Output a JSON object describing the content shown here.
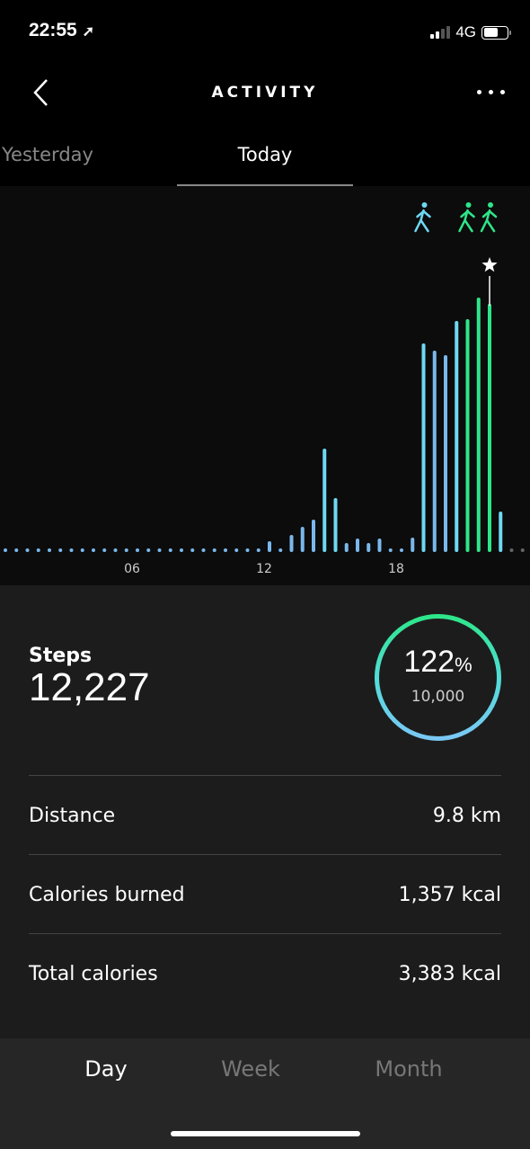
{
  "status": {
    "time": "22:55",
    "network": "4G",
    "battery_level": 0.6,
    "signal_bars": 2
  },
  "header": {
    "title": "ACTIVITY",
    "back_icon": "chevron-left-icon",
    "more_icon": "more-horizontal-icon"
  },
  "day_tabs": [
    {
      "label": "Yesterday",
      "visible_text": "erday"
    },
    {
      "label": "Today",
      "selected": true
    }
  ],
  "colors": {
    "low": "#7ab8ec",
    "medium": "#6fd8f2",
    "high": "#2ee68a",
    "future": "#666666",
    "ring_top": "#2ee68a",
    "ring_bottom": "#7ac8f5"
  },
  "chart_data": {
    "type": "bar",
    "x_unit": "half-hour bins of the day",
    "x_ticks": [
      "06",
      "12",
      "18"
    ],
    "x_range": [
      "00:00",
      "24:00"
    ],
    "values": [
      0,
      0,
      0,
      0,
      0,
      0,
      0,
      0,
      0,
      0,
      0,
      0,
      0,
      0,
      0,
      0,
      0,
      0,
      0,
      0,
      0,
      0,
      0,
      0,
      48,
      0,
      90,
      144,
      192,
      666,
      336,
      36,
      66,
      36,
      66,
      0,
      0,
      72,
      1368,
      1320,
      1290,
      1518,
      1530,
      1674,
      1632,
      246,
      null,
      null
    ],
    "levels": [
      "low",
      "low",
      "low",
      "low",
      "low",
      "low",
      "low",
      "low",
      "low",
      "low",
      "low",
      "low",
      "low",
      "low",
      "low",
      "low",
      "low",
      "low",
      "low",
      "low",
      "low",
      "low",
      "low",
      "low",
      "low",
      "low",
      "low",
      "low",
      "low",
      "medium",
      "medium",
      "low",
      "low",
      "low",
      "low",
      "low",
      "low",
      "low",
      "medium",
      "low",
      "low",
      "medium",
      "high",
      "high",
      "high",
      "medium",
      "future",
      "future"
    ],
    "peak_star_bin": 44,
    "activity_markers": [
      {
        "icon": "walking-icon",
        "bin": 38,
        "level": "medium"
      },
      {
        "icon": "running-icon",
        "bin": 42,
        "level": "high"
      },
      {
        "icon": "running-icon",
        "bin": 44,
        "level": "high"
      }
    ],
    "grid": false
  },
  "summary": {
    "steps_label": "Steps",
    "steps_value": "12,227",
    "goal_percent": "122",
    "percent_sign": "%",
    "goal_value": "10,000",
    "goal_fraction": 1.22
  },
  "stats": [
    {
      "label": "Distance",
      "value": "9.8 km"
    },
    {
      "label": "Calories burned",
      "value": "1,357 kcal"
    },
    {
      "label": "Total calories",
      "value": "3,383 kcal"
    }
  ],
  "period_tabs": [
    {
      "label": "Day",
      "selected": true
    },
    {
      "label": "Week"
    },
    {
      "label": "Month"
    }
  ]
}
